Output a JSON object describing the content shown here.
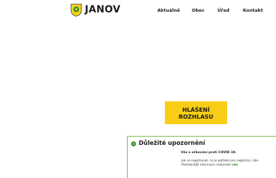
{
  "header": {
    "logo_text": "JANOV",
    "crest_icon": "municipal-coat-of-arms",
    "nav": [
      {
        "label": "Aktuálně"
      },
      {
        "label": "Obec"
      },
      {
        "label": "Úřad"
      },
      {
        "label": "Kontakt"
      }
    ]
  },
  "main": {
    "hlaseni_button": "HLÁŠENÍ ROZHLASU"
  },
  "notice": {
    "icon": "info-dot-icon",
    "title": "Důležité upozornění",
    "line1": "Vše o očkování proti COVID-19.",
    "line2": "Jak se registrovat, co je potřeba pro registraci, kde ",
    "line3": "Podrobnější informace naleznete ",
    "link": "zde"
  },
  "colors": {
    "accent_yellow": "#f7cd16",
    "accent_green": "#6dbf4b",
    "text": "#1a1a1a",
    "background": "#ffffff"
  }
}
